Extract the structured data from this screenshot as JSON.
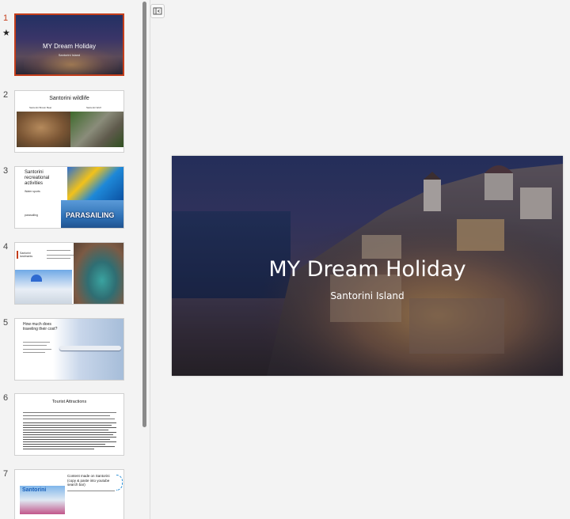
{
  "thumbnails": [
    {
      "number": "1",
      "title": "MY Dream Holiday",
      "subtitle": "Santorini Island",
      "selected": true
    },
    {
      "number": "2",
      "title": "Santorini wildlife",
      "captions": [
        "Santorini Brown Bear",
        "Santorini Wolf"
      ]
    },
    {
      "number": "3",
      "title": "Santorini recreational activities",
      "bullets": [
        "Water sports",
        "parasailing"
      ],
      "image_text": "PARASAILING"
    },
    {
      "number": "4",
      "title": "Santorini landmarks"
    },
    {
      "number": "5",
      "title": "How much does traveling their cost?"
    },
    {
      "number": "6",
      "title": "Tourist Attractions"
    },
    {
      "number": "7",
      "title": "Content made on Santorini (copy & paste into youtube search bar)",
      "image_text": "Santorini"
    }
  ],
  "main_slide": {
    "title": "MY Dream Holiday",
    "subtitle": "Santorini Island"
  },
  "icons": {
    "start_marker": "★",
    "collapse": "panel-collapse-icon"
  },
  "colors": {
    "selection": "#c43e1c",
    "pane_bg": "#f3f3f3"
  }
}
